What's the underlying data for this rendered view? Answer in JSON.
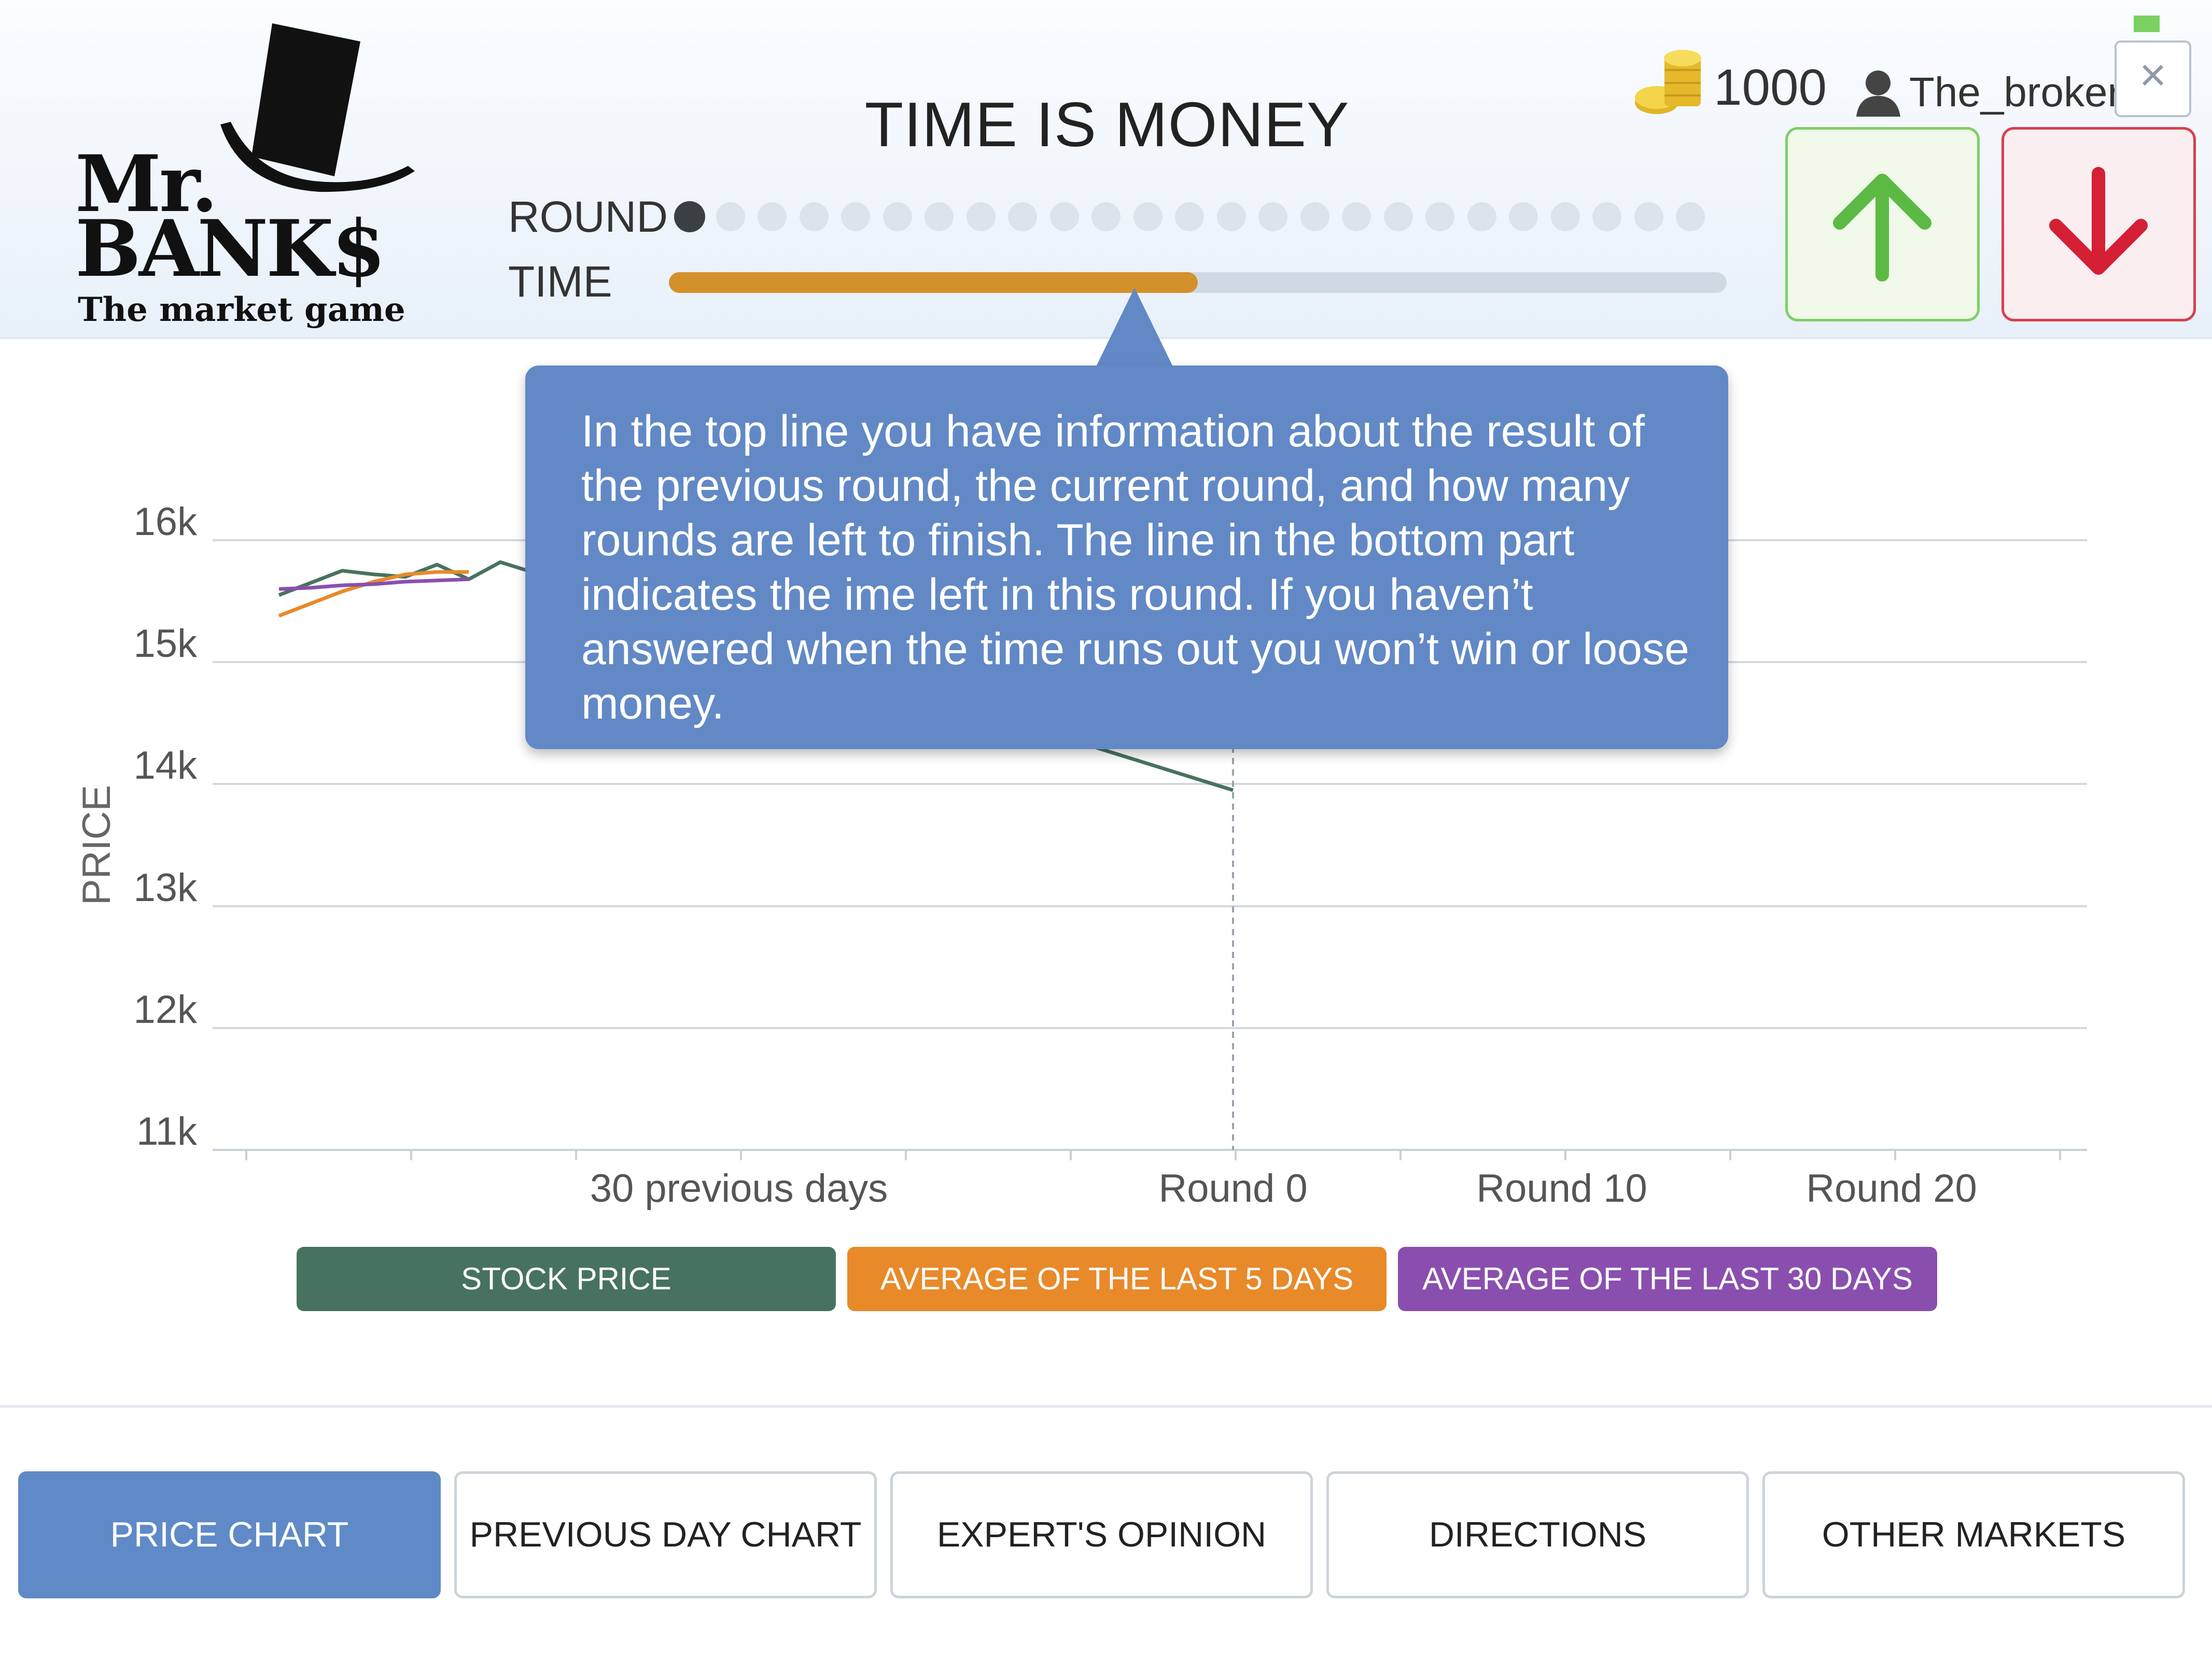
{
  "brand": {
    "line1": "Mr.",
    "line2": "BANK$",
    "tagline": "The market game"
  },
  "game": {
    "title": "TIME IS MONEY",
    "round_label": "ROUND",
    "time_label": "TIME",
    "current_round_index": 0,
    "total_rounds": 25,
    "time_remaining_fraction": 0.5
  },
  "account": {
    "coins": "1000",
    "username": "The_broker",
    "close_glyph": "×"
  },
  "controls": {
    "buy_icon": "arrow-up-icon",
    "sell_icon": "arrow-down-icon"
  },
  "tooltip": {
    "text": "In the top line you have information about the result of the previous round, the current round, and how many rounds are left to finish. The line in the bottom part indicates the ime left in this round. If you haven’t answered when the time runs out you won’t win or loose money."
  },
  "chart_data": {
    "type": "line",
    "ylabel": "PRICE",
    "xlabel": "",
    "y_ticks": [
      "16k",
      "15k",
      "14k",
      "13k",
      "12k",
      "11k"
    ],
    "x_tick_labels": [
      "30 previous days",
      "Round 0",
      "Round 10",
      "Round 20"
    ],
    "grid": true,
    "legend_placement": "bottom",
    "series": [
      {
        "name": "STOCK PRICE",
        "color": "#47735e",
        "values": [
          15.55,
          15.65,
          15.75,
          15.72,
          15.7,
          15.8,
          15.68,
          15.82,
          13.95
        ]
      },
      {
        "name": "AVERAGE OF THE LAST 5 DAYS",
        "color": "#e88a2a",
        "values": [
          15.38,
          15.48,
          15.58,
          15.66,
          15.72,
          15.74,
          15.74
        ]
      },
      {
        "name": "AVERAGE OF THE LAST 30 DAYS",
        "color": "#8a4fae",
        "values": [
          15.6,
          15.61,
          15.63,
          15.64,
          15.66,
          15.67,
          15.68
        ]
      }
    ]
  },
  "legend": {
    "stock": "STOCK PRICE",
    "avg5": "AVERAGE OF THE LAST 5 DAYS",
    "avg30": "AVERAGE OF THE LAST 30 DAYS",
    "colors": {
      "stock": "#47735e",
      "avg5": "#e88a2a",
      "avg30": "#8a4fae"
    }
  },
  "tabs": [
    {
      "label": "PRICE CHART",
      "active": true
    },
    {
      "label": "PREVIOUS DAY CHART",
      "active": false
    },
    {
      "label": "EXPERT'S OPINION",
      "active": false
    },
    {
      "label": "DIRECTIONS",
      "active": false
    },
    {
      "label": "OTHER MARKETS",
      "active": false
    }
  ]
}
